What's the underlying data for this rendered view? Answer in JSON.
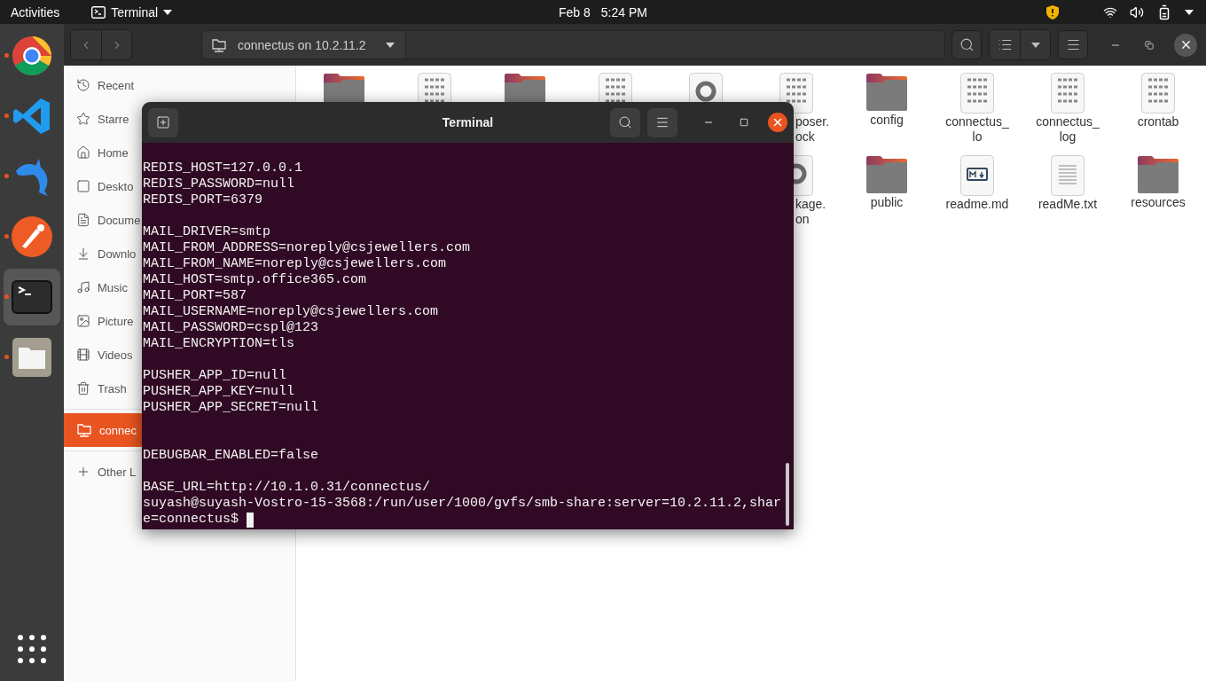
{
  "top_bar": {
    "activities": "Activities",
    "app_menu": "Terminal",
    "date": "Feb 8",
    "time": "5:24 PM"
  },
  "dock": {
    "apps": [
      {
        "kind": "browser",
        "running": true,
        "active": false
      },
      {
        "kind": "code",
        "running": true,
        "active": false
      },
      {
        "kind": "dolphin",
        "running": true,
        "active": false
      },
      {
        "kind": "pen",
        "running": true,
        "active": false
      },
      {
        "kind": "terminal",
        "running": true,
        "active": true
      },
      {
        "kind": "files",
        "running": true,
        "active": false
      }
    ]
  },
  "files_window": {
    "path": "connectus on 10.2.11.2",
    "sidebar": {
      "sections": [
        {
          "items": [
            {
              "kind": "recent",
              "label": "Recent",
              "selected": false
            },
            {
              "kind": "starred",
              "label": "Starre",
              "selected": false
            },
            {
              "kind": "home",
              "label": "Home",
              "selected": false
            },
            {
              "kind": "desktop",
              "label": "Deskto",
              "selected": false
            },
            {
              "kind": "documents",
              "label": "Docume",
              "selected": false
            },
            {
              "kind": "downloads",
              "label": "Downlo",
              "selected": false
            },
            {
              "kind": "music",
              "label": "Music",
              "selected": false
            },
            {
              "kind": "pictures",
              "label": "Picture",
              "selected": false
            },
            {
              "kind": "videos",
              "label": "Videos",
              "selected": false
            },
            {
              "kind": "trash",
              "label": "Trash",
              "selected": false
            }
          ]
        },
        {
          "items": [
            {
              "kind": "network",
              "label": "connec",
              "selected": true
            }
          ]
        },
        {
          "items": [
            {
              "kind": "other",
              "label": "Other L",
              "selected": false
            }
          ]
        }
      ]
    },
    "grid": [
      {
        "items": [
          {
            "kind": "folder"
          },
          {
            "kind": "binary"
          },
          {
            "kind": "folder"
          },
          {
            "kind": "binary"
          },
          {
            "kind": "json"
          },
          {
            "kind": "binary",
            "label": "poser.\nock",
            "cut_off": true
          },
          {
            "kind": "folder",
            "label": "config"
          },
          {
            "kind": "binary",
            "label": "connectus_\nlo"
          },
          {
            "kind": "binary",
            "label": "connectus_\nlog"
          },
          {
            "kind": "binary",
            "label": "crontab"
          }
        ]
      },
      {
        "items": [
          {
            "kind": "json",
            "label": "kage.\non",
            "cut_off": true
          },
          {
            "kind": "folder",
            "label": "public"
          },
          {
            "kind": "markdown",
            "label": "readme.md"
          },
          {
            "kind": "text",
            "label": "readMe.txt"
          },
          {
            "kind": "folder",
            "label": "resources"
          }
        ]
      }
    ]
  },
  "terminal": {
    "title": "Terminal",
    "lines": [
      {
        "kind": "blank"
      },
      {
        "kind": "text",
        "text": "REDIS_HOST=127.0.0.1"
      },
      {
        "kind": "text",
        "text": "REDIS_PASSWORD=null"
      },
      {
        "kind": "text",
        "text": "REDIS_PORT=6379"
      },
      {
        "kind": "blank"
      },
      {
        "kind": "text",
        "text": "MAIL_DRIVER=smtp"
      },
      {
        "kind": "text",
        "text": "MAIL_FROM_ADDRESS=noreply@csjewellers.com"
      },
      {
        "kind": "text",
        "text": "MAIL_FROM_NAME=noreply@csjewellers.com"
      },
      {
        "kind": "text",
        "text": "MAIL_HOST=smtp.office365.com"
      },
      {
        "kind": "text",
        "text": "MAIL_PORT=587"
      },
      {
        "kind": "text",
        "text": "MAIL_USERNAME=noreply@csjewellers.com"
      },
      {
        "kind": "text",
        "text": "MAIL_PASSWORD=cspl@123"
      },
      {
        "kind": "text",
        "text": "MAIL_ENCRYPTION=tls"
      },
      {
        "kind": "blank"
      },
      {
        "kind": "text",
        "text": "PUSHER_APP_ID=null"
      },
      {
        "kind": "text",
        "text": "PUSHER_APP_KEY=null"
      },
      {
        "kind": "text",
        "text": "PUSHER_APP_SECRET=null"
      },
      {
        "kind": "blank"
      },
      {
        "kind": "blank"
      },
      {
        "kind": "text",
        "text": "DEBUGBAR_ENABLED=false"
      },
      {
        "kind": "blank"
      },
      {
        "kind": "text",
        "text": "BASE_URL=http://10.1.0.31/connectus/"
      },
      {
        "kind": "text",
        "text": "suyash@suyash-Vostro-15-3568:/run/user/1000/gvfs/smb-share:server=10.2.11.2,shar"
      },
      {
        "kind": "prompt",
        "text": "e=connectus$"
      }
    ]
  }
}
